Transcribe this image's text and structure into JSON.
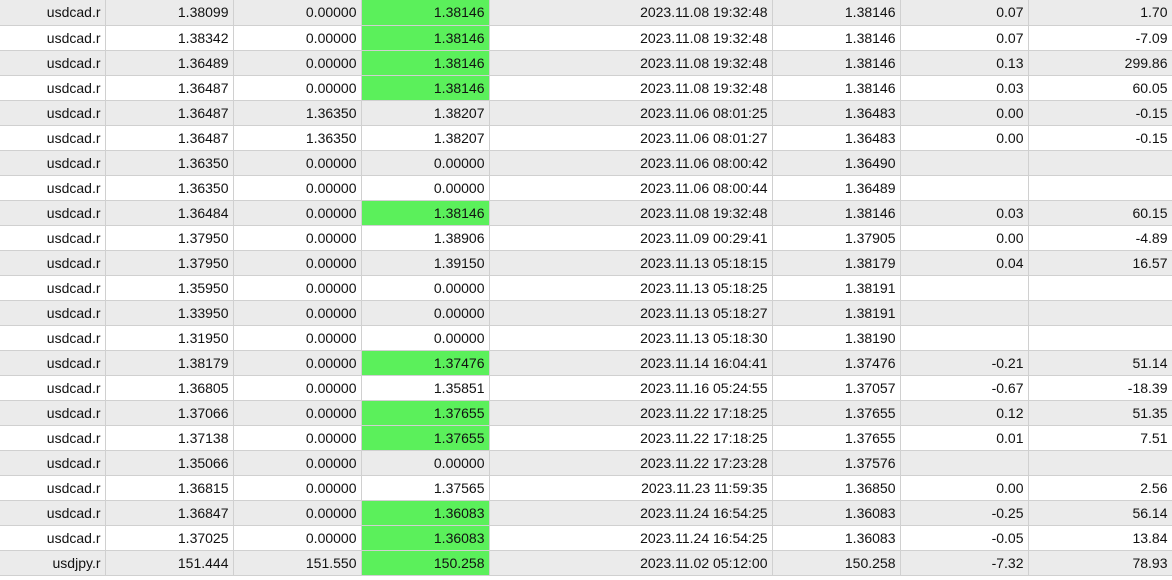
{
  "rows": [
    {
      "symbol": "usdcad.r",
      "price": "1.38099",
      "sl": "0.00000",
      "tp": "1.38146",
      "tp_hit": true,
      "time": "2023.11.08 19:32:48",
      "close": "1.38146",
      "swap": "0.07",
      "profit": "1.70"
    },
    {
      "symbol": "usdcad.r",
      "price": "1.38342",
      "sl": "0.00000",
      "tp": "1.38146",
      "tp_hit": true,
      "time": "2023.11.08 19:32:48",
      "close": "1.38146",
      "swap": "0.07",
      "profit": "-7.09"
    },
    {
      "symbol": "usdcad.r",
      "price": "1.36489",
      "sl": "0.00000",
      "tp": "1.38146",
      "tp_hit": true,
      "time": "2023.11.08 19:32:48",
      "close": "1.38146",
      "swap": "0.13",
      "profit": "299.86"
    },
    {
      "symbol": "usdcad.r",
      "price": "1.36487",
      "sl": "0.00000",
      "tp": "1.38146",
      "tp_hit": true,
      "time": "2023.11.08 19:32:48",
      "close": "1.38146",
      "swap": "0.03",
      "profit": "60.05"
    },
    {
      "symbol": "usdcad.r",
      "price": "1.36487",
      "sl": "1.36350",
      "tp": "1.38207",
      "tp_hit": false,
      "time": "2023.11.06 08:01:25",
      "close": "1.36483",
      "swap": "0.00",
      "profit": "-0.15"
    },
    {
      "symbol": "usdcad.r",
      "price": "1.36487",
      "sl": "1.36350",
      "tp": "1.38207",
      "tp_hit": false,
      "time": "2023.11.06 08:01:27",
      "close": "1.36483",
      "swap": "0.00",
      "profit": "-0.15"
    },
    {
      "symbol": "usdcad.r",
      "price": "1.36350",
      "sl": "0.00000",
      "tp": "0.00000",
      "tp_hit": false,
      "time": "2023.11.06 08:00:42",
      "close": "1.36490",
      "swap": "",
      "profit": ""
    },
    {
      "symbol": "usdcad.r",
      "price": "1.36350",
      "sl": "0.00000",
      "tp": "0.00000",
      "tp_hit": false,
      "time": "2023.11.06 08:00:44",
      "close": "1.36489",
      "swap": "",
      "profit": ""
    },
    {
      "symbol": "usdcad.r",
      "price": "1.36484",
      "sl": "0.00000",
      "tp": "1.38146",
      "tp_hit": true,
      "time": "2023.11.08 19:32:48",
      "close": "1.38146",
      "swap": "0.03",
      "profit": "60.15"
    },
    {
      "symbol": "usdcad.r",
      "price": "1.37950",
      "sl": "0.00000",
      "tp": "1.38906",
      "tp_hit": false,
      "time": "2023.11.09 00:29:41",
      "close": "1.37905",
      "swap": "0.00",
      "profit": "-4.89"
    },
    {
      "symbol": "usdcad.r",
      "price": "1.37950",
      "sl": "0.00000",
      "tp": "1.39150",
      "tp_hit": false,
      "time": "2023.11.13 05:18:15",
      "close": "1.38179",
      "swap": "0.04",
      "profit": "16.57"
    },
    {
      "symbol": "usdcad.r",
      "price": "1.35950",
      "sl": "0.00000",
      "tp": "0.00000",
      "tp_hit": false,
      "time": "2023.11.13 05:18:25",
      "close": "1.38191",
      "swap": "",
      "profit": ""
    },
    {
      "symbol": "usdcad.r",
      "price": "1.33950",
      "sl": "0.00000",
      "tp": "0.00000",
      "tp_hit": false,
      "time": "2023.11.13 05:18:27",
      "close": "1.38191",
      "swap": "",
      "profit": ""
    },
    {
      "symbol": "usdcad.r",
      "price": "1.31950",
      "sl": "0.00000",
      "tp": "0.00000",
      "tp_hit": false,
      "time": "2023.11.13 05:18:30",
      "close": "1.38190",
      "swap": "",
      "profit": ""
    },
    {
      "symbol": "usdcad.r",
      "price": "1.38179",
      "sl": "0.00000",
      "tp": "1.37476",
      "tp_hit": true,
      "time": "2023.11.14 16:04:41",
      "close": "1.37476",
      "swap": "-0.21",
      "profit": "51.14"
    },
    {
      "symbol": "usdcad.r",
      "price": "1.36805",
      "sl": "0.00000",
      "tp": "1.35851",
      "tp_hit": false,
      "time": "2023.11.16 05:24:55",
      "close": "1.37057",
      "swap": "-0.67",
      "profit": "-18.39"
    },
    {
      "symbol": "usdcad.r",
      "price": "1.37066",
      "sl": "0.00000",
      "tp": "1.37655",
      "tp_hit": true,
      "time": "2023.11.22 17:18:25",
      "close": "1.37655",
      "swap": "0.12",
      "profit": "51.35"
    },
    {
      "symbol": "usdcad.r",
      "price": "1.37138",
      "sl": "0.00000",
      "tp": "1.37655",
      "tp_hit": true,
      "time": "2023.11.22 17:18:25",
      "close": "1.37655",
      "swap": "0.01",
      "profit": "7.51"
    },
    {
      "symbol": "usdcad.r",
      "price": "1.35066",
      "sl": "0.00000",
      "tp": "0.00000",
      "tp_hit": false,
      "time": "2023.11.22 17:23:28",
      "close": "1.37576",
      "swap": "",
      "profit": ""
    },
    {
      "symbol": "usdcad.r",
      "price": "1.36815",
      "sl": "0.00000",
      "tp": "1.37565",
      "tp_hit": false,
      "time": "2023.11.23 11:59:35",
      "close": "1.36850",
      "swap": "0.00",
      "profit": "2.56"
    },
    {
      "symbol": "usdcad.r",
      "price": "1.36847",
      "sl": "0.00000",
      "tp": "1.36083",
      "tp_hit": true,
      "time": "2023.11.24 16:54:25",
      "close": "1.36083",
      "swap": "-0.25",
      "profit": "56.14"
    },
    {
      "symbol": "usdcad.r",
      "price": "1.37025",
      "sl": "0.00000",
      "tp": "1.36083",
      "tp_hit": true,
      "time": "2023.11.24 16:54:25",
      "close": "1.36083",
      "swap": "-0.05",
      "profit": "13.84"
    },
    {
      "symbol": "usdjpy.r",
      "price": "151.444",
      "sl": "151.550",
      "tp": "150.258",
      "tp_hit": true,
      "time": "2023.11.02 05:12:00",
      "close": "150.258",
      "swap": "-7.32",
      "profit": "78.93"
    }
  ]
}
